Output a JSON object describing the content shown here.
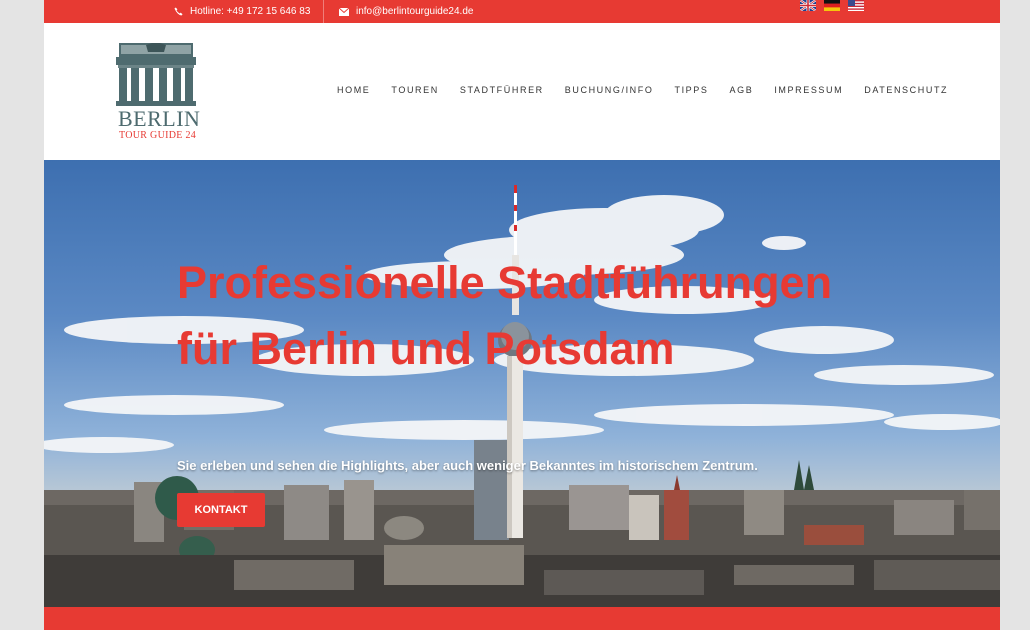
{
  "topbar": {
    "hotline": "Hotline: +49 172 15 646 83",
    "email": "info@berlintourguide24.de",
    "languages": [
      "en-flag-icon",
      "de-flag-icon",
      "us-flag-icon"
    ]
  },
  "logo": {
    "line1": "BERLIN",
    "line2": "TOUR GUIDE 24"
  },
  "nav": {
    "items": [
      "HOME",
      "TOUREN",
      "STADTFÜHRER",
      "BUCHUNG/INFO",
      "TIPPS",
      "AGB",
      "IMPRESSUM",
      "DATENSCHUTZ"
    ]
  },
  "hero": {
    "title": "Professionelle Stadtführungen für Berlin und Potsdam",
    "subtitle": "Sie erleben und sehen die Highlights, aber auch weniger Bekanntes im historischem Zentrum.",
    "cta": "KONTAKT"
  },
  "colors": {
    "brand_red": "#e73a33",
    "logo_teal": "#4e6b6f"
  }
}
